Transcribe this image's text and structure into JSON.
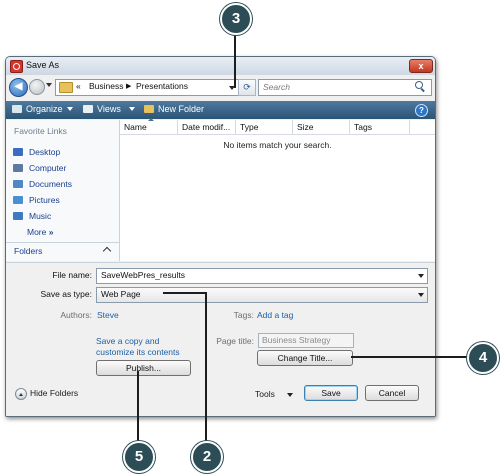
{
  "window": {
    "title": "Save As",
    "close_glyph": "x"
  },
  "nav": {
    "breadcrumb": [
      "«",
      "Business",
      "Presentations"
    ],
    "search_placeholder": "Search"
  },
  "toolbar": {
    "organize": "Organize",
    "views": "Views",
    "new_folder": "New Folder",
    "help": "?"
  },
  "sidebar": {
    "heading": "Favorite Links",
    "items": [
      {
        "label": "Desktop",
        "icon": "desktop-icon",
        "color": "#3b6cc4"
      },
      {
        "label": "Computer",
        "icon": "computer-icon",
        "color": "#5d7aa0"
      },
      {
        "label": "Documents",
        "icon": "documents-icon",
        "color": "#4e86c6"
      },
      {
        "label": "Pictures",
        "icon": "pictures-icon",
        "color": "#4a8fd0"
      },
      {
        "label": "Music",
        "icon": "music-icon",
        "color": "#3f79c0"
      }
    ],
    "more": "More",
    "more_glyph": "»",
    "folders": "Folders"
  },
  "file_list": {
    "columns": [
      "Name",
      "Date modif...",
      "Type",
      "Size",
      "Tags"
    ],
    "empty_message": "No items match your search."
  },
  "form": {
    "file_name_label": "File name:",
    "file_name_value": "SaveWebPres_results",
    "save_type_label": "Save as type:",
    "save_type_value": "Web Page",
    "authors_label": "Authors:",
    "authors_value": "Steve",
    "tags_label": "Tags:",
    "tags_value": "Add a tag",
    "save_copy_line1": "Save a copy and",
    "save_copy_line2": "customize its contents",
    "page_title_label": "Page title:",
    "page_title_value": "Business Strategy",
    "change_title": "Change Title...",
    "publish": "Publish...",
    "hide_folders": "Hide Folders",
    "tools": "Tools",
    "save": "Save",
    "cancel": "Cancel"
  },
  "callouts": [
    "3",
    "4",
    "5",
    "2"
  ],
  "colors": {
    "callout": "#2c4d55",
    "toolbar": "#3b6688",
    "link": "#1c5fa6"
  }
}
